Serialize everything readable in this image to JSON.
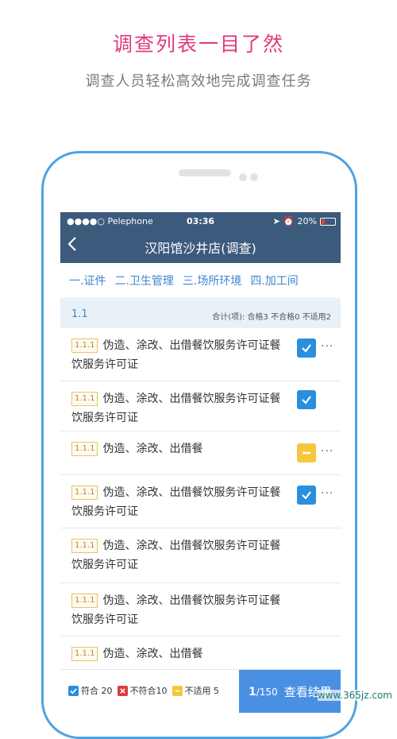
{
  "promo": {
    "title": "调查列表一目了然",
    "subtitle": "调查人员轻松高效地完成调查任务"
  },
  "status_bar": {
    "carrier": "●●●●○ Pelephone",
    "time": "03:36",
    "battery": "20%"
  },
  "nav": {
    "back_icon": "chevron-left-icon",
    "title": "汉阳馆沙井店(调查)"
  },
  "tabs": [
    {
      "label": "一.证件"
    },
    {
      "label": "二.卫生管理"
    },
    {
      "label": "三.场所环境"
    },
    {
      "label": "四.加工间"
    }
  ],
  "group": {
    "name": "1.1",
    "summary": "合计(项): 合格3   不合格0   不适用2"
  },
  "items": [
    {
      "code": "1.1.1",
      "text": "伪造、涂改、出借餐饮服务许可证餐饮服务许可证",
      "status": "pass",
      "more": true
    },
    {
      "code": "1.1.1",
      "text": "伪造、涂改、出借餐饮服务许可证餐饮服务许可证",
      "status": "pass",
      "more": false
    },
    {
      "code": "1.1.1",
      "text": "伪造、涂改、出借餐",
      "status": "na",
      "more": true
    },
    {
      "code": "1.1.1",
      "text": "伪造、涂改、出借餐饮服务许可证餐饮服务许可证",
      "status": "pass",
      "more": true
    },
    {
      "code": "1.1.1",
      "text": "伪造、涂改、出借餐饮服务许可证餐饮服务许可证",
      "status": "none",
      "more": false
    },
    {
      "code": "1.1.1",
      "text": "伪造、涂改、出借餐饮服务许可证餐饮服务许可证",
      "status": "none",
      "more": false
    },
    {
      "code": "1.1.1",
      "text": "伪造、涂改、出借餐",
      "status": "none",
      "more": false
    }
  ],
  "footer": {
    "pass_label": "符合 20",
    "fail_label": "不符合10",
    "na_label": "不适用 5",
    "page_current": "1",
    "page_total": "/150",
    "result_label": "查看结果"
  },
  "watermark": "www.365jz.com",
  "colors": {
    "accent_pink": "#e2387b",
    "nav_bg": "#3b5a7c",
    "tab_blue": "#3d86d4",
    "pass_blue": "#2a8fde",
    "fail_red": "#e23a3a",
    "na_yellow": "#f5c73c",
    "result_btn": "#4a90e2"
  }
}
